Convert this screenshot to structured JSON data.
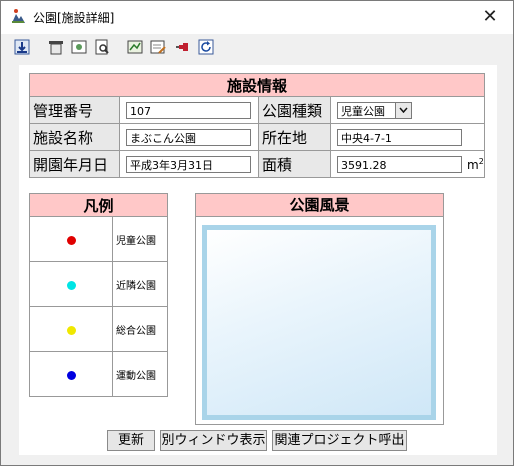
{
  "window": {
    "title": "公園[施設詳細]",
    "close_glyph": "✕"
  },
  "toolbar": {
    "buttons": [
      {
        "name": "download-icon"
      },
      {
        "name": "layer-icon"
      },
      {
        "name": "image-icon"
      },
      {
        "name": "preview-icon"
      },
      {
        "name": "map-edit-icon"
      },
      {
        "name": "form-edit-icon"
      },
      {
        "name": "pin-icon"
      },
      {
        "name": "refresh-icon"
      }
    ]
  },
  "facility": {
    "header": "施設情報",
    "labels": {
      "id": "管理番号",
      "type": "公園種類",
      "name": "施設名称",
      "address": "所在地",
      "opened": "開園年月日",
      "area": "面積"
    },
    "values": {
      "id": "107",
      "type": "児童公園",
      "name": "まぶこん公園",
      "address": "中央4-7-1",
      "opened": "平成3年3月31日",
      "area": "3591.28"
    },
    "area_unit_base": "m",
    "area_unit_exp": "2"
  },
  "legend": {
    "header": "凡例",
    "items": [
      {
        "label": "児童公園",
        "color": "#e00000"
      },
      {
        "label": "近隣公園",
        "color": "#00e5e5"
      },
      {
        "label": "総合公園",
        "color": "#f0e800"
      },
      {
        "label": "運動公園",
        "color": "#0000e0"
      }
    ]
  },
  "scene": {
    "header": "公園風景"
  },
  "buttons": {
    "update": "更新",
    "open_window": "別ウィンドウ表示",
    "related_project": "関連プロジェクト呼出"
  }
}
